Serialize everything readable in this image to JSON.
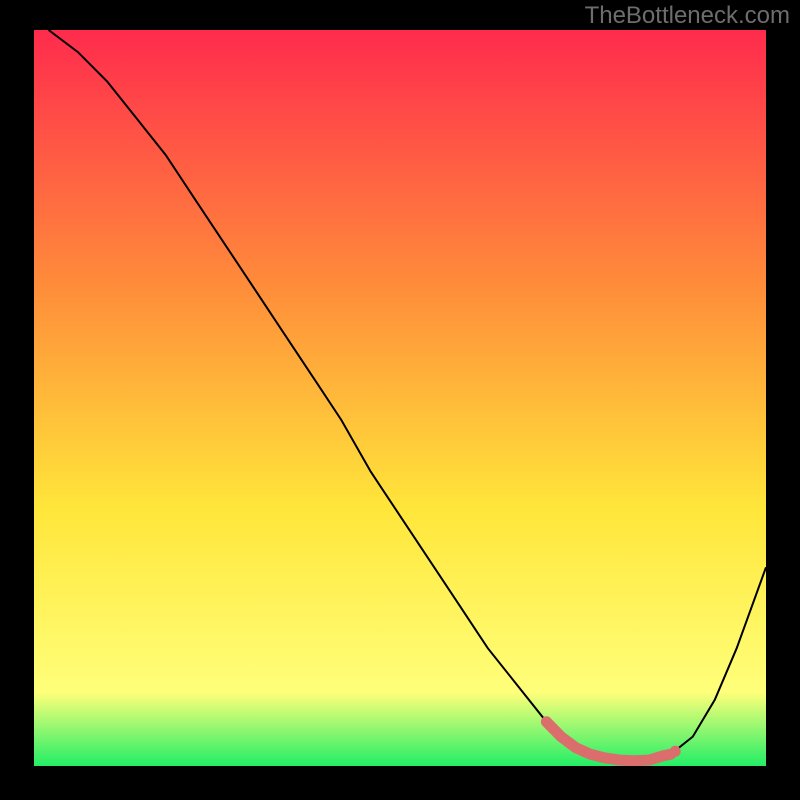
{
  "watermark": "TheBottleneck.com",
  "chart_data": {
    "type": "line",
    "title": "",
    "xlabel": "",
    "ylabel": "",
    "xlim": [
      0,
      100
    ],
    "ylim": [
      0,
      100
    ],
    "grid": false,
    "series": [
      {
        "name": "bottleneck-curve",
        "color": "#000000",
        "x": [
          2,
          6,
          10,
          14,
          18,
          22,
          26,
          30,
          34,
          38,
          42,
          46,
          50,
          54,
          58,
          62,
          66,
          70,
          72,
          74,
          76,
          78,
          80,
          82,
          84,
          87,
          90,
          93,
          96,
          100
        ],
        "y": [
          100,
          97,
          93,
          88,
          83,
          77,
          71,
          65,
          59,
          53,
          47,
          40,
          34,
          28,
          22,
          16,
          11,
          6,
          4,
          2.5,
          1.6,
          1.1,
          0.8,
          0.7,
          0.8,
          1.6,
          4,
          9,
          16,
          27
        ]
      }
    ],
    "optimum_range": {
      "name": "optimum-zone",
      "color": "#dc6d6d",
      "x": [
        70,
        72,
        74,
        76,
        78,
        80,
        82,
        84,
        86,
        87
      ],
      "y": [
        6,
        4,
        2.5,
        1.6,
        1.1,
        0.8,
        0.7,
        0.8,
        1.4,
        1.6
      ]
    },
    "background_gradient": {
      "top": "#ff2b4d",
      "mid1": "#ff8d3a",
      "mid2": "#ffe63a",
      "mid3": "#ffff7a",
      "bottom": "#22ee66"
    }
  }
}
